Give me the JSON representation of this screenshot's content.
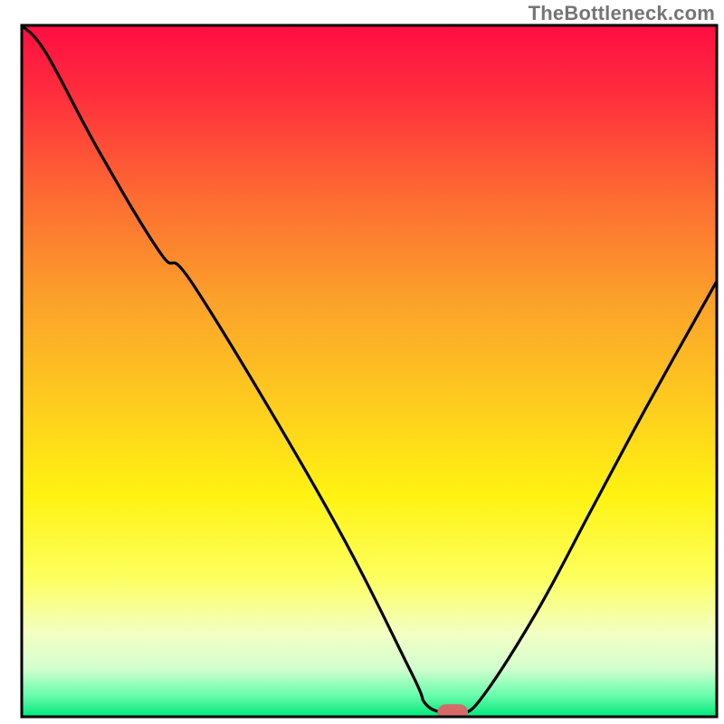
{
  "attribution": "TheBottleneck.com",
  "chart_data": {
    "type": "line",
    "title": "",
    "xlabel": "",
    "ylabel": "",
    "xlim": [
      0,
      100
    ],
    "ylim": [
      0,
      100
    ],
    "grid": false,
    "legend": false,
    "gradient_stops": [
      {
        "offset": 0.0,
        "color": "#ff0d42"
      },
      {
        "offset": 0.1,
        "color": "#ff2e3d"
      },
      {
        "offset": 0.25,
        "color": "#fd6c32"
      },
      {
        "offset": 0.4,
        "color": "#fba22a"
      },
      {
        "offset": 0.55,
        "color": "#fecd1e"
      },
      {
        "offset": 0.68,
        "color": "#fff312"
      },
      {
        "offset": 0.8,
        "color": "#fdff60"
      },
      {
        "offset": 0.88,
        "color": "#f3ffc4"
      },
      {
        "offset": 0.93,
        "color": "#d3ffcf"
      },
      {
        "offset": 0.97,
        "color": "#66fcab"
      },
      {
        "offset": 1.0,
        "color": "#00e77a"
      }
    ],
    "series": [
      {
        "name": "bottleneck-curve",
        "x": [
          0.0,
          3.5,
          11.0,
          20.0,
          25.0,
          44.0,
          56.0,
          58.0,
          60.5,
          63.0,
          66.0,
          74.0,
          82.0,
          90.0,
          100.0
        ],
        "y": [
          100.0,
          96.0,
          82.0,
          67.0,
          62.0,
          30.0,
          6.5,
          2.0,
          0.6,
          0.6,
          2.5,
          15.0,
          30.0,
          45.0,
          63.0
        ]
      }
    ],
    "marker": {
      "name": "optimal-point",
      "x": 62.0,
      "y": 0.6,
      "rx_pct": 2.2,
      "ry_pct": 1.2,
      "fill": "#d46a6a"
    },
    "frame": {
      "left_pct": 3.0,
      "top_pct": 3.5,
      "right_pct": 99.0,
      "bottom_pct": 99.0,
      "stroke": "#000000",
      "stroke_width": 3
    },
    "curve_stroke": "#000000",
    "curve_stroke_width": 3.2
  }
}
